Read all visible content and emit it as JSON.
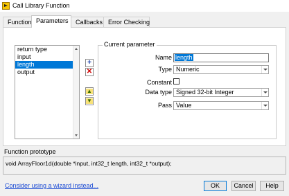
{
  "window": {
    "title": "Call Library Function"
  },
  "tabs": [
    {
      "label": "Function"
    },
    {
      "label": "Parameters"
    },
    {
      "label": "Callbacks"
    },
    {
      "label": "Error Checking"
    }
  ],
  "active_tab": "Parameters",
  "parameters_list": [
    "return type",
    "input",
    "length",
    "output"
  ],
  "selected_parameter": "length",
  "current_parameter": {
    "group_title": "Current parameter",
    "name_label": "Name",
    "name_value": "length",
    "type_label": "Type",
    "type_value": "Numeric",
    "constant_label": "Constant",
    "constant_checked": false,
    "data_type_label": "Data type",
    "data_type_value": "Signed 32-bit Integer",
    "pass_label": "Pass",
    "pass_value": "Value"
  },
  "prototype": {
    "label": "Function prototype",
    "text": "void  ArrayFloor1d(double *input, int32_t length, int32_t *output);"
  },
  "footer": {
    "wizard_link": "Consider using a wizard instead...",
    "ok": "OK",
    "cancel": "Cancel",
    "help": "Help"
  },
  "icons": {
    "app": "labview-vi-icon",
    "add": "add-parameter-icon",
    "delete": "delete-parameter-icon",
    "move_up": "move-up-icon",
    "move_down": "move-down-icon"
  },
  "colors": {
    "selection": "#0078d7",
    "link": "#1a4ad4",
    "delete": "#d00000"
  }
}
